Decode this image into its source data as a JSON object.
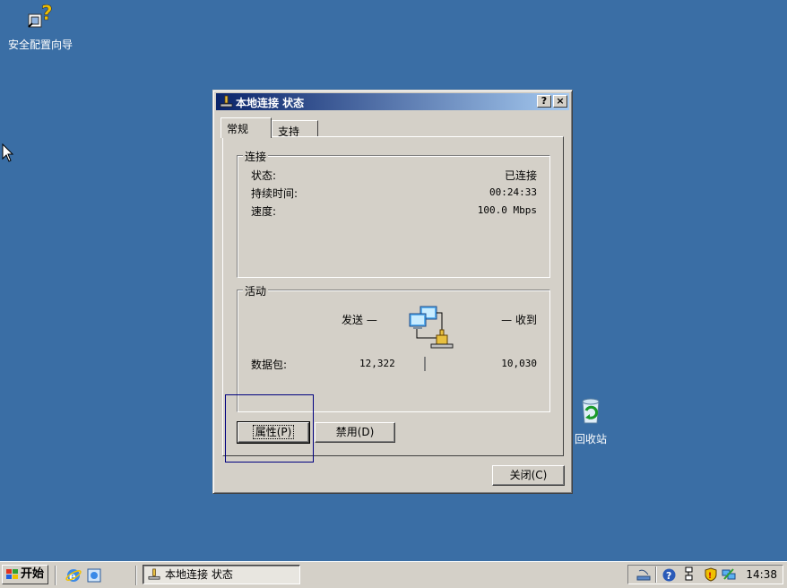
{
  "desktop": {
    "icons": [
      {
        "label": "安全配置向导",
        "icon": "security-wizard-icon"
      },
      {
        "label": "回收站",
        "icon": "recycle-bin-icon"
      }
    ]
  },
  "dialog": {
    "title": "本地连接 状态",
    "help_button": "?",
    "close_button": "×",
    "tabs": [
      "常规",
      "支持"
    ],
    "connection": {
      "group_label": "连接",
      "status_label": "状态:",
      "status_value": "已连接",
      "duration_label": "持续时间:",
      "duration_value": "00:24:33",
      "speed_label": "速度:",
      "speed_value": "100.0 Mbps"
    },
    "activity": {
      "group_label": "活动",
      "sent_label": "发送 —",
      "received_label": "— 收到",
      "packets_label": "数据包:",
      "packets_sent": "12,322",
      "packets_received": "10,030"
    },
    "buttons": {
      "properties": "属性(P)",
      "disable": "禁用(D)",
      "close": "关闭(C)"
    }
  },
  "taskbar": {
    "start_label": "开始",
    "quick_launch": [
      "internet-explorer-icon",
      "explorer-icon"
    ],
    "task_item": "本地连接 状态",
    "clock": "14:38"
  }
}
